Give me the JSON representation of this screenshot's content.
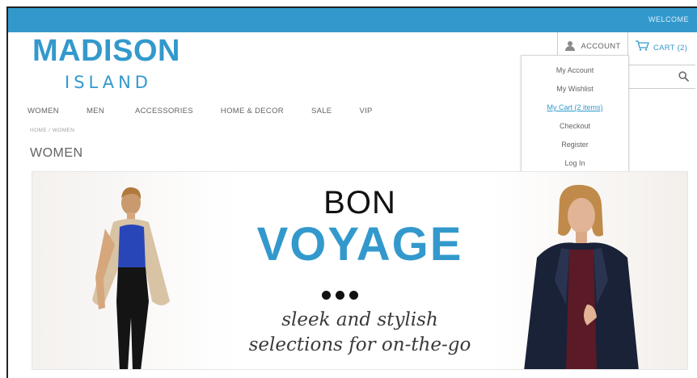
{
  "header": {
    "welcome": "WELCOME",
    "logo_main": "MADISON",
    "logo_sub": "ISLAND",
    "account_label": "ACCOUNT",
    "cart_label": "CART (2)",
    "search_icon": "search-icon",
    "colors": {
      "brand": "#3399cc",
      "text": "#636363"
    }
  },
  "nav": {
    "items": [
      "WOMEN",
      "MEN",
      "ACCESSORIES",
      "HOME & DECOR",
      "SALE",
      "VIP"
    ]
  },
  "breadcrumb": "HOME / WOMEN",
  "page_title": "WOMEN",
  "account_menu": {
    "items": [
      {
        "label": "My Account",
        "active": false
      },
      {
        "label": "My Wishlist",
        "active": false
      },
      {
        "label": "My Cart (2 items)",
        "active": true
      },
      {
        "label": "Checkout",
        "active": false
      },
      {
        "label": "Register",
        "active": false
      },
      {
        "label": "Log In",
        "active": false
      }
    ]
  },
  "banner": {
    "line1": "BON",
    "line2": "VOYAGE",
    "tagline1": "sleek and stylish",
    "tagline2": "selections for on-the-go"
  }
}
